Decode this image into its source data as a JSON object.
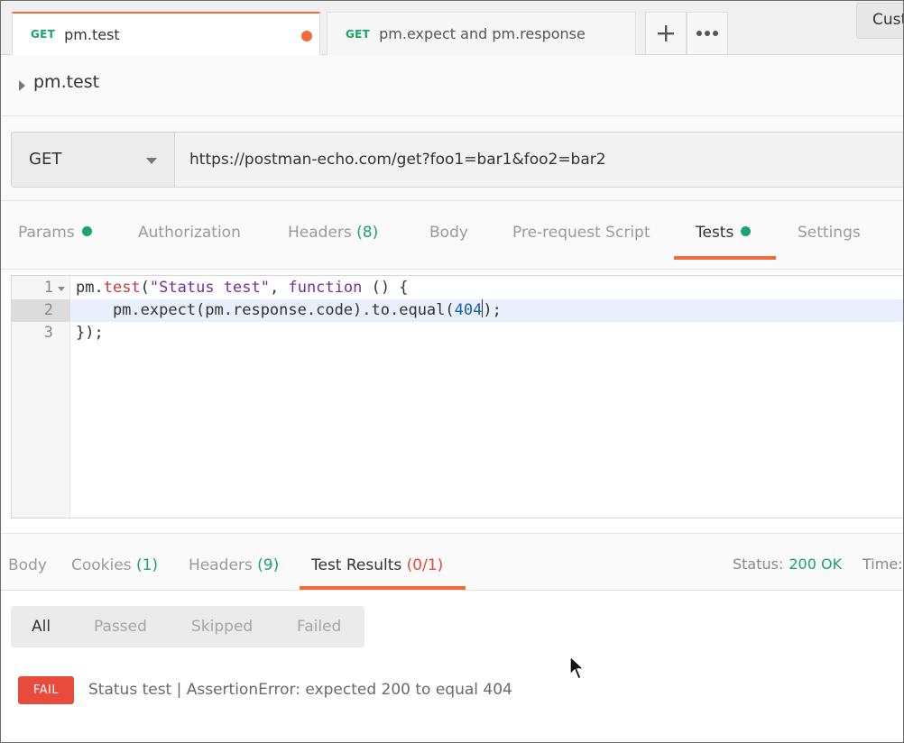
{
  "tabs": [
    {
      "method": "GET",
      "name": "pm.test",
      "unsaved": true
    },
    {
      "method": "GET",
      "name": "pm.expect and pm.response"
    }
  ],
  "tab_actions": {
    "add_icon": "plus-icon",
    "more_icon": "ellipsis-icon"
  },
  "top_right_button": "Cust",
  "request": {
    "name": "pm.test",
    "method": "GET",
    "url": "https://postman-echo.com/get?foo1=bar1&foo2=bar2"
  },
  "request_tabs": {
    "params": "Params",
    "authorization": "Authorization",
    "headers": "Headers",
    "headers_count": "(8)",
    "body": "Body",
    "prerequest": "Pre-request Script",
    "tests": "Tests",
    "settings": "Settings",
    "active": "Tests"
  },
  "editor": {
    "lines": [
      {
        "num": "1"
      },
      {
        "num": "2"
      },
      {
        "num": "3"
      }
    ],
    "tokens": {
      "l1_a": "pm.",
      "l1_b": "test",
      "l1_c": "(",
      "l1_d": "\"Status test\"",
      "l1_e": ", ",
      "l1_f": "function",
      "l1_g": " () {",
      "l2_a": "    pm.expect(pm.response.code).to.equal(",
      "l2_b": "404",
      "l2_c": ");",
      "l3_a": "});"
    },
    "highlighted_line": 2
  },
  "response_tabs": {
    "body": "Body",
    "cookies": "Cookies",
    "cookies_count": "(1)",
    "headers": "Headers",
    "headers_count": "(9)",
    "test_results": "Test Results",
    "test_results_count": "(0/1)",
    "active": "Test Results"
  },
  "response_status": {
    "status_label": "Status:",
    "status_value": "200 OK",
    "time_label": "Time:"
  },
  "filters": {
    "all": "All",
    "passed": "Passed",
    "skipped": "Skipped",
    "failed": "Failed",
    "active": "All"
  },
  "results": [
    {
      "badge": "FAIL",
      "text": "Status test | AssertionError: expected 200 to equal 404"
    }
  ],
  "colors": {
    "accent": "#f26b3a",
    "success": "#1aa56a",
    "fail": "#e84a3b"
  }
}
